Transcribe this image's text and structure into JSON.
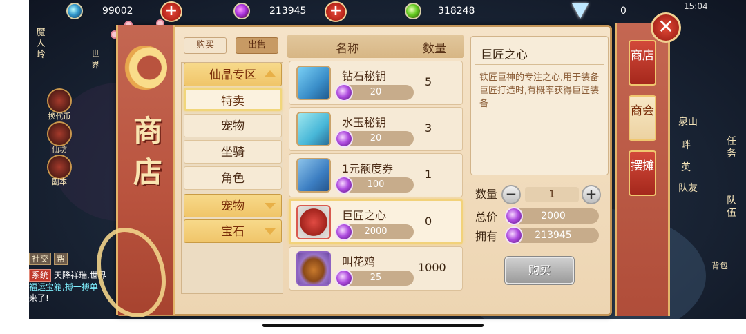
{
  "status": {
    "time": "15:04"
  },
  "currencies": [
    {
      "icon": "blue-gem-icon",
      "value": "99002"
    },
    {
      "icon": "purple-gem-icon",
      "value": "213945"
    },
    {
      "icon": "green-gem-icon",
      "value": "318248"
    },
    {
      "icon": "diamond-icon",
      "value": "0"
    }
  ],
  "left_hud": {
    "zone_name": "魔人岭",
    "world": "世界",
    "exchange": "换代币",
    "fairy": "仙坊",
    "copy": "副本"
  },
  "right_hud": {
    "task": "任务",
    "team": "队伍",
    "bag": "背包",
    "place1": "泉山",
    "place2": "畔",
    "place3": "英",
    "place4": "队友"
  },
  "chat": {
    "tabs": [
      "社交",
      "帮"
    ],
    "lines": [
      {
        "tag": "系统",
        "text": "天降祥瑞,世界"
      },
      {
        "tag": "",
        "text": "福运宝箱,搏一搏单"
      },
      {
        "tag": "",
        "text": "来了!"
      }
    ]
  },
  "shop": {
    "banner_title": "商店",
    "tabs": {
      "buy": "购买",
      "sell": "出售"
    },
    "categories": [
      {
        "label": "仙晶专区",
        "type": "group",
        "arrow": "up"
      },
      {
        "label": "特卖",
        "type": "selected"
      },
      {
        "label": "宠物",
        "type": "item"
      },
      {
        "label": "坐骑",
        "type": "item"
      },
      {
        "label": "角色",
        "type": "item"
      },
      {
        "label": "宠物",
        "type": "group",
        "arrow": "down"
      },
      {
        "label": "宝石",
        "type": "group",
        "arrow": "down"
      }
    ],
    "list_header": {
      "name": "名称",
      "qty": "数量"
    },
    "items": [
      {
        "name": "钻石秘钥",
        "price": "20",
        "qty": "5",
        "icon": "diamond-key-icon",
        "selected": false
      },
      {
        "name": "水玉秘钥",
        "price": "20",
        "qty": "3",
        "icon": "jade-key-icon",
        "selected": false
      },
      {
        "name": "1元额度券",
        "price": "100",
        "qty": "1",
        "icon": "voucher-scroll-icon",
        "selected": false
      },
      {
        "name": "巨匠之心",
        "price": "2000",
        "qty": "0",
        "icon": "craftsman-heart-icon",
        "selected": true
      },
      {
        "name": "叫花鸡",
        "price": "25",
        "qty": "1000",
        "icon": "roast-chicken-icon",
        "selected": false
      }
    ],
    "detail": {
      "title": "巨匠之心",
      "description": "铁匠巨神的专注之心,用于装备巨匠打造时,有概率获得巨匠装备"
    },
    "purchase": {
      "qty_label": "数量",
      "qty_value": "1",
      "total_label": "总价",
      "total_value": "2000",
      "own_label": "拥有",
      "own_value": "213945",
      "buy_button": "购买"
    },
    "side_tabs": [
      {
        "label": "商店",
        "selected": false
      },
      {
        "label": "商会",
        "selected": true
      },
      {
        "label": "摆摊",
        "selected": false
      }
    ],
    "close_symbol": "✕"
  },
  "colors": {
    "accent": "#c49558",
    "banner": "#b9533e",
    "price_coin": "#b04ee0"
  }
}
